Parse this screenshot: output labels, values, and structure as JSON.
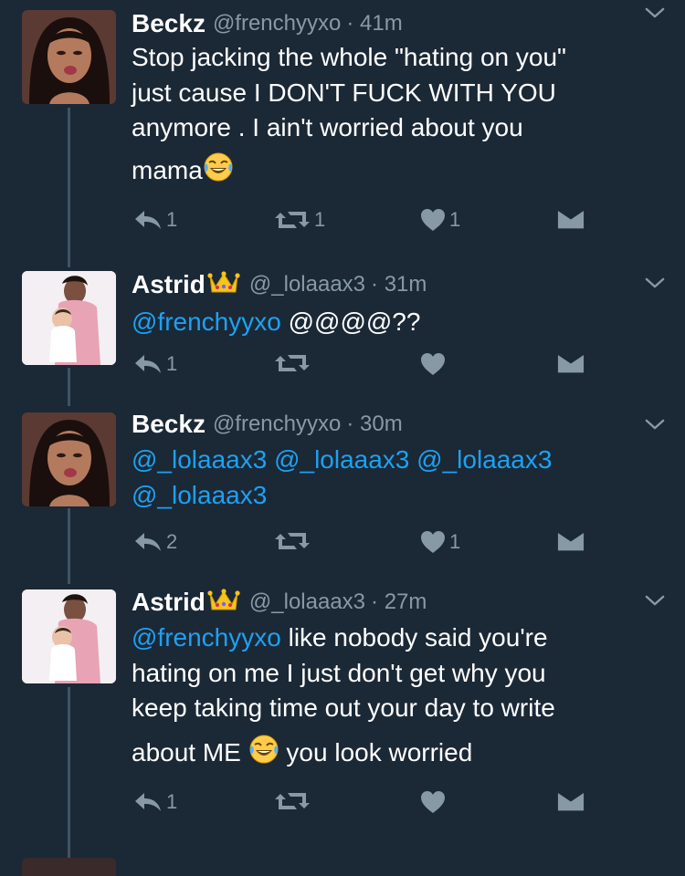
{
  "tweets": [
    {
      "name": "Beckz",
      "handle": "@frenchyyxo",
      "time": "· 41m",
      "crown": false,
      "avatar": "woman-selfie",
      "lines": [
        "Stop jacking the whole \"hating on you\"",
        "just cause I DON'T FUCK WITH YOU",
        "anymore . I ain't worried about you",
        "mama"
      ],
      "emoji": "laughing-tears-emoji",
      "counts": {
        "reply": "1",
        "retweet": "1",
        "like": "1"
      }
    },
    {
      "name": "Astrid",
      "handle": "@_lolaaax3",
      "time": "· 31m",
      "crown": true,
      "avatar": "mother-and-baby",
      "mention": "@frenchyyxo",
      "text": " @@@@??",
      "counts": {
        "reply": "1",
        "retweet": "",
        "like": ""
      }
    },
    {
      "name": "Beckz",
      "handle": "@frenchyyxo",
      "time": "· 30m",
      "crown": false,
      "avatar": "woman-selfie",
      "mentions_line1": "@_lolaaax3 @_lolaaax3 @_lolaaax3",
      "mentions_line2": "@_lolaaax3",
      "counts": {
        "reply": "2",
        "retweet": "",
        "like": "1"
      }
    },
    {
      "name": "Astrid",
      "handle": "@_lolaaax3",
      "time": "· 27m",
      "crown": true,
      "avatar": "mother-and-baby",
      "mention": "@frenchyyxo",
      "line1_rest": " like nobody said you're",
      "line2": "hating on me I just don't get why you",
      "line3": "keep taking time out your day to write",
      "line4_a": "about ME ",
      "line4_b": " you look worried",
      "counts": {
        "reply": "1",
        "retweet": "",
        "like": ""
      }
    }
  ],
  "icons": {
    "reply": "reply-icon",
    "retweet": "retweet-icon",
    "like": "heart-icon",
    "dm": "envelope-icon",
    "more": "chevron-down-icon"
  },
  "colors": {
    "background": "#1b2836",
    "mention": "#1da1f2",
    "muted": "#8899a6",
    "thread": "#3d5466"
  }
}
